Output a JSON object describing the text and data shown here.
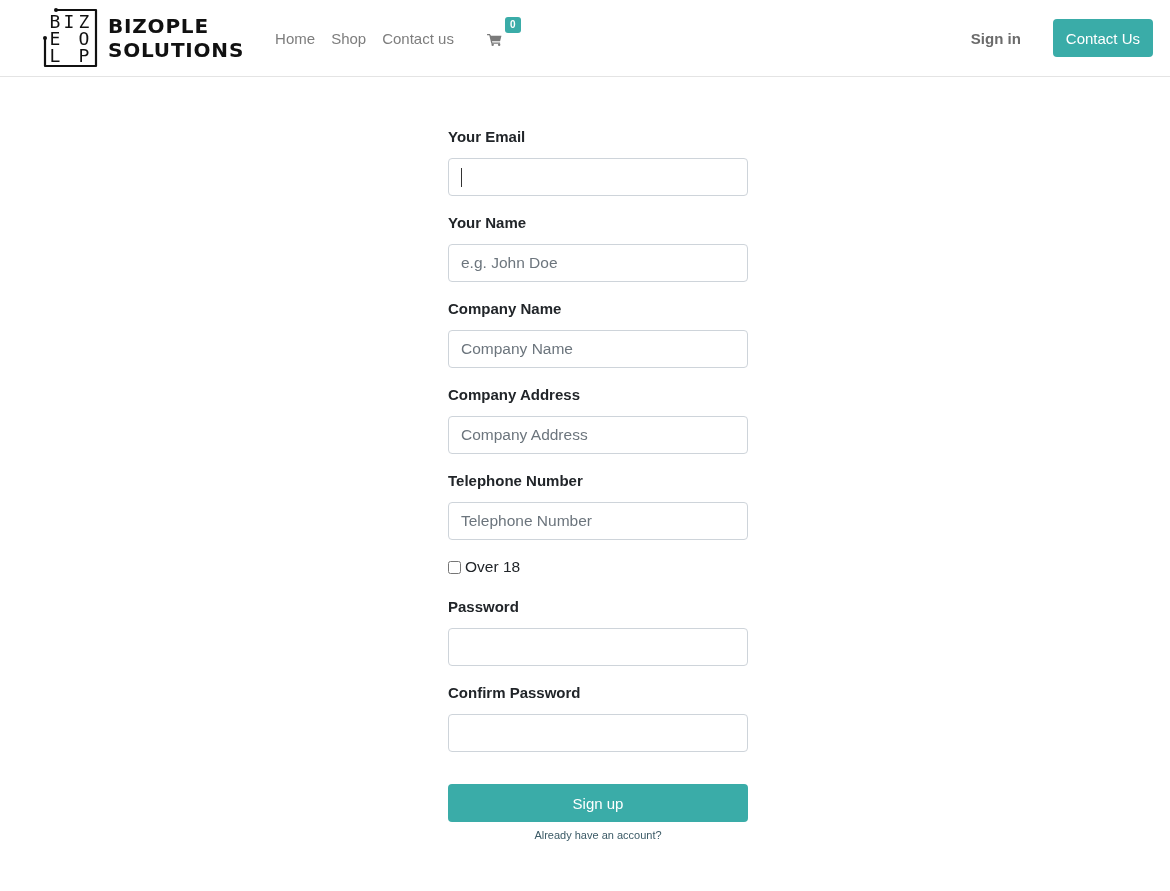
{
  "header": {
    "logo": {
      "mark_rows": [
        [
          "B",
          "I",
          "Z"
        ],
        [
          "E",
          "O"
        ],
        [
          "L",
          "P"
        ]
      ],
      "wordmark": [
        "BIZOPLE",
        "SOLUTIONS"
      ]
    },
    "nav": [
      {
        "label": "Home"
      },
      {
        "label": "Shop"
      },
      {
        "label": "Contact us"
      }
    ],
    "cart": {
      "badge": "0"
    },
    "sign_in": "Sign in",
    "cta_button": "Contact Us"
  },
  "form": {
    "fields": [
      {
        "kind": "email",
        "label": "Your Email",
        "focused": true
      },
      {
        "kind": "text",
        "label": "Your Name",
        "placeholder": "e.g. John Doe",
        "focused": false
      },
      {
        "kind": "text",
        "label": "Company Name",
        "placeholder": "Company Name",
        "focused": false
      },
      {
        "kind": "text",
        "label": "Company Address",
        "placeholder": "Company Address",
        "focused": false
      },
      {
        "kind": "text",
        "label": "Telephone Number",
        "placeholder": "Telephone Number",
        "focused": false
      },
      {
        "kind": "checkbox",
        "label": "Over 18",
        "checked": false,
        "focused": false
      },
      {
        "kind": "password",
        "label": "Password",
        "focused": false
      },
      {
        "kind": "password",
        "label": "Confirm Password",
        "focused": false
      }
    ],
    "submit_button": "Sign up",
    "account_link": "Already have an account?"
  }
}
